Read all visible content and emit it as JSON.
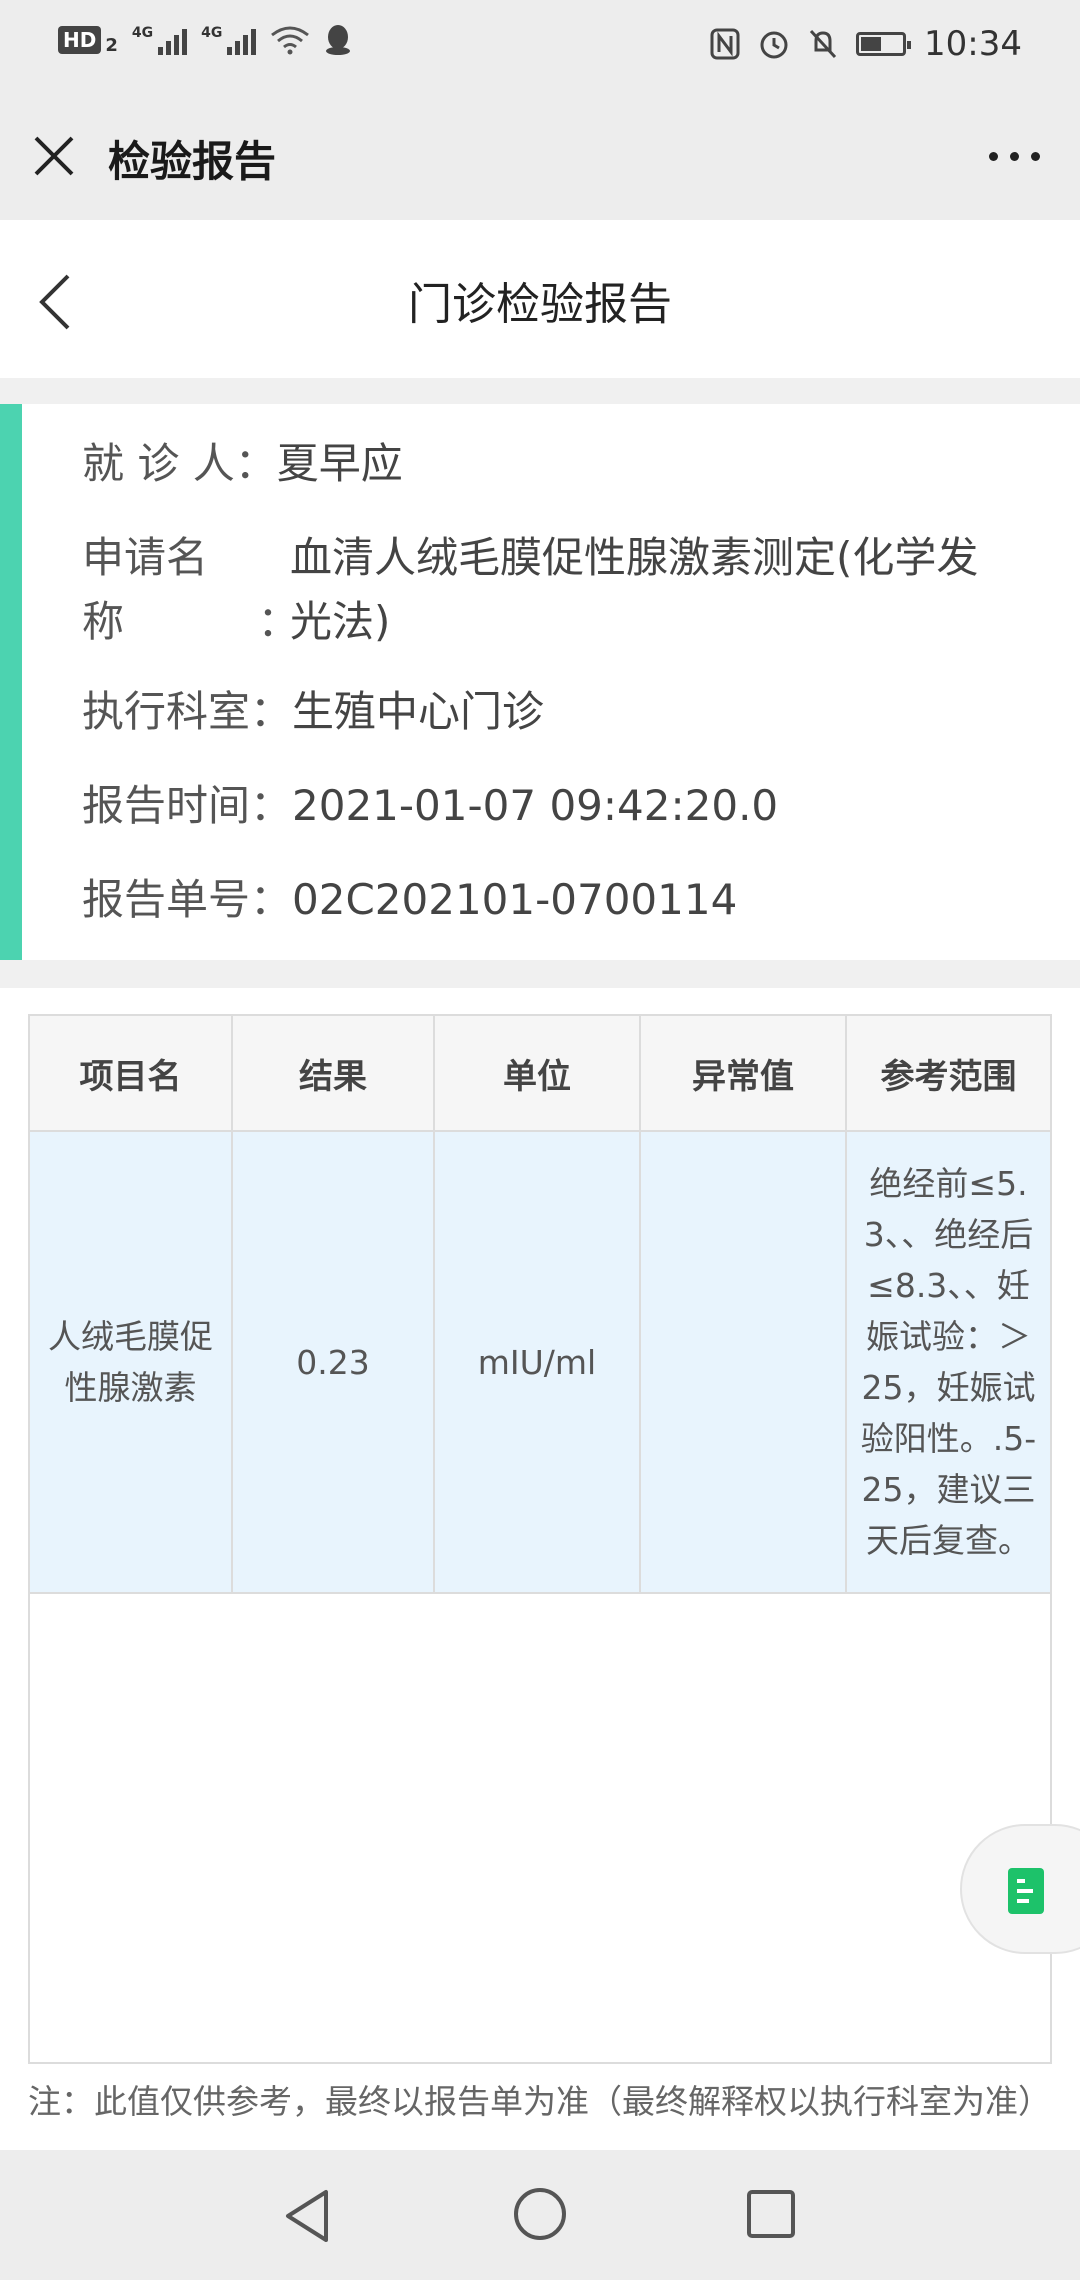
{
  "status_bar": {
    "hd_badge": "HD",
    "hd_sub": "2",
    "sig1_label": "4G",
    "sig2_label": "4G",
    "battery_level": 0.5,
    "time": "10:34"
  },
  "titlebar": {
    "title": "检验报告"
  },
  "subheader": {
    "title": "门诊检验报告"
  },
  "info": {
    "patient_label": "就 诊 人：",
    "patient_value": "夏早应",
    "request_label_line1": "申请名",
    "request_value_line1": "血清人绒毛膜促性腺激素测定(化学发",
    "request_label_line2": "称          ：",
    "request_value_line2": "光法)",
    "dept_label": "执行科室：",
    "dept_value": "生殖中心门诊",
    "time_label": "报告时间：",
    "time_value": "2021-01-07 09:42:20.0",
    "report_no_label": "报告单号：",
    "report_no_value": "02C202101-0700114"
  },
  "table": {
    "headers": [
      "项目名",
      "结果",
      "单位",
      "异常值",
      "参考范围"
    ],
    "rows": [
      {
        "item": "人绒毛膜促性腺激素",
        "result": "0.23",
        "unit": "mIU/ml",
        "abnormal": "",
        "reference": "绝经前≤5.3、、绝经后≤8.3、、妊娠试验：＞25，妊娠试验阳性。.5-25，建议三天后复查。"
      }
    ]
  },
  "note": "注：此值仅供参考，最终以报告单为准（最终解释权以执行科室为准）",
  "colors": {
    "accent": "#4cd3b0",
    "row_bg": "#e8f4fd",
    "doc_icon": "#1dc26a"
  },
  "icons": [
    "close-icon",
    "more-icon",
    "back-icon",
    "document-icon",
    "nav-back-icon",
    "nav-home-icon",
    "nav-recent-icon"
  ]
}
